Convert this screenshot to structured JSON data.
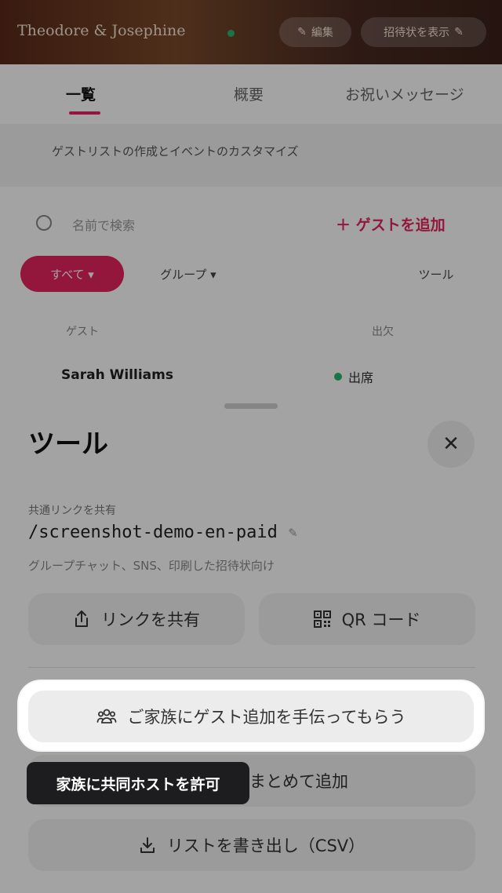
{
  "header": {
    "title": "Theodore & Josephine",
    "edit_label": "編集",
    "web_label": "招待状を表示"
  },
  "tabs": [
    {
      "label": "一覧"
    },
    {
      "label": "概要"
    },
    {
      "label": "お祝いメッセージ"
    }
  ],
  "notice": "ゲストリストの作成とイベントのカスタマイズ",
  "search": {
    "placeholder": "名前で検索"
  },
  "add_guest_label": "＋ ゲストを追加",
  "filters": {
    "all": "すべて ▾",
    "group": "グループ ▾",
    "tools": "ツール"
  },
  "table": {
    "columns": [
      "ゲスト",
      "出欠"
    ],
    "rows": [
      {
        "name": "Sarah Williams",
        "status": "出席"
      }
    ]
  },
  "sheet": {
    "title": "ツール",
    "close_symbol": "✕",
    "share_link_label": "共通リンクを共有",
    "link_path": "/screenshot-demo-en-paid",
    "link_hint": "グループチャット、SNS、印刷した招待状向け",
    "share_button": "リンクを共有",
    "qr_button": "QR コード",
    "family_button": "ご家族にゲスト追加を手伝ってもらう",
    "bulk_button": "まとめて追加",
    "csv_button": "リストを書き出し（CSV）"
  },
  "tooltip": "家族に共同ホストを許可",
  "colors": {
    "accent": "#e6245e",
    "attending": "#2bb673"
  }
}
